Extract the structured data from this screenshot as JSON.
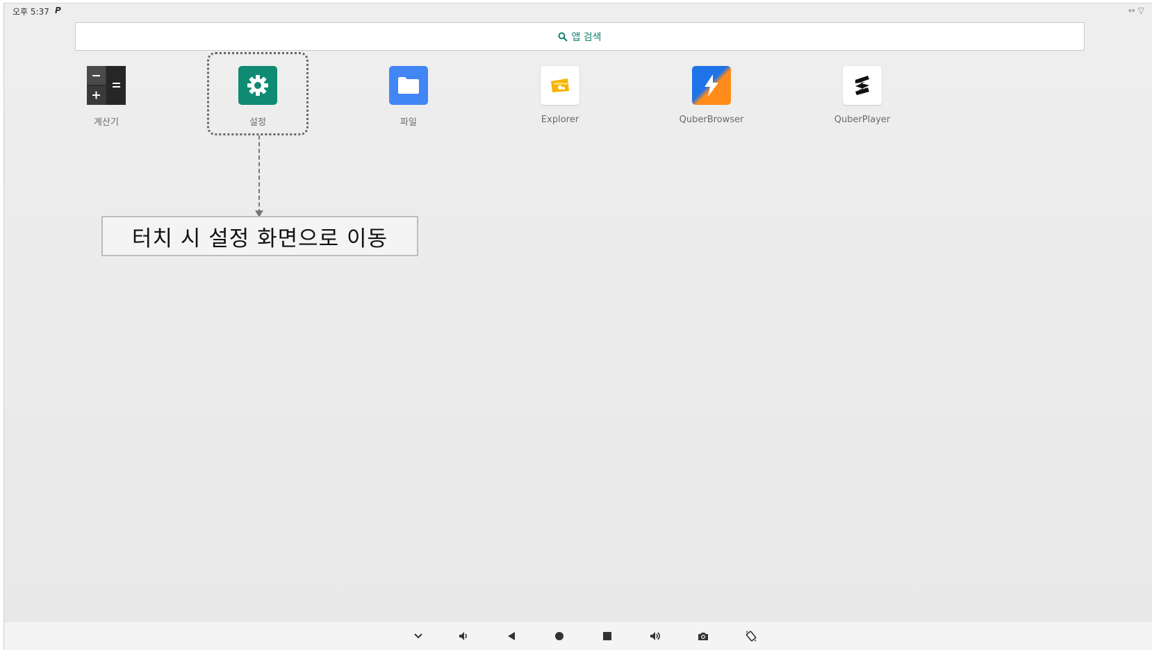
{
  "status_bar": {
    "time": "오후 5:37",
    "notification_glyph": "P",
    "right_icons": [
      "expand-arrows-icon",
      "wifi-icon"
    ]
  },
  "search": {
    "label": "앱 검색",
    "icon": "search-icon",
    "accent_color": "#12806f"
  },
  "apps": [
    {
      "label": "계산기",
      "icon": "calculator-icon"
    },
    {
      "label": "설정",
      "icon": "settings-gear-icon",
      "color": "#0f8a73"
    },
    {
      "label": "파일",
      "icon": "folder-icon",
      "color": "#4285f4"
    },
    {
      "label": "Explorer",
      "icon": "explorer-icon",
      "color": "#f5b400"
    },
    {
      "label": "QuberBrowser",
      "icon": "quberbrowser-icon"
    },
    {
      "label": "QuberPlayer",
      "icon": "quberplayer-icon"
    }
  ],
  "callout": {
    "text": "터치 시 설정 화면으로 이동"
  },
  "nav_bar": {
    "buttons": [
      "collapse-chevron-icon",
      "volume-down-icon",
      "back-icon",
      "home-icon",
      "recents-icon",
      "volume-up-icon",
      "screenshot-icon",
      "rotate-icon"
    ]
  }
}
